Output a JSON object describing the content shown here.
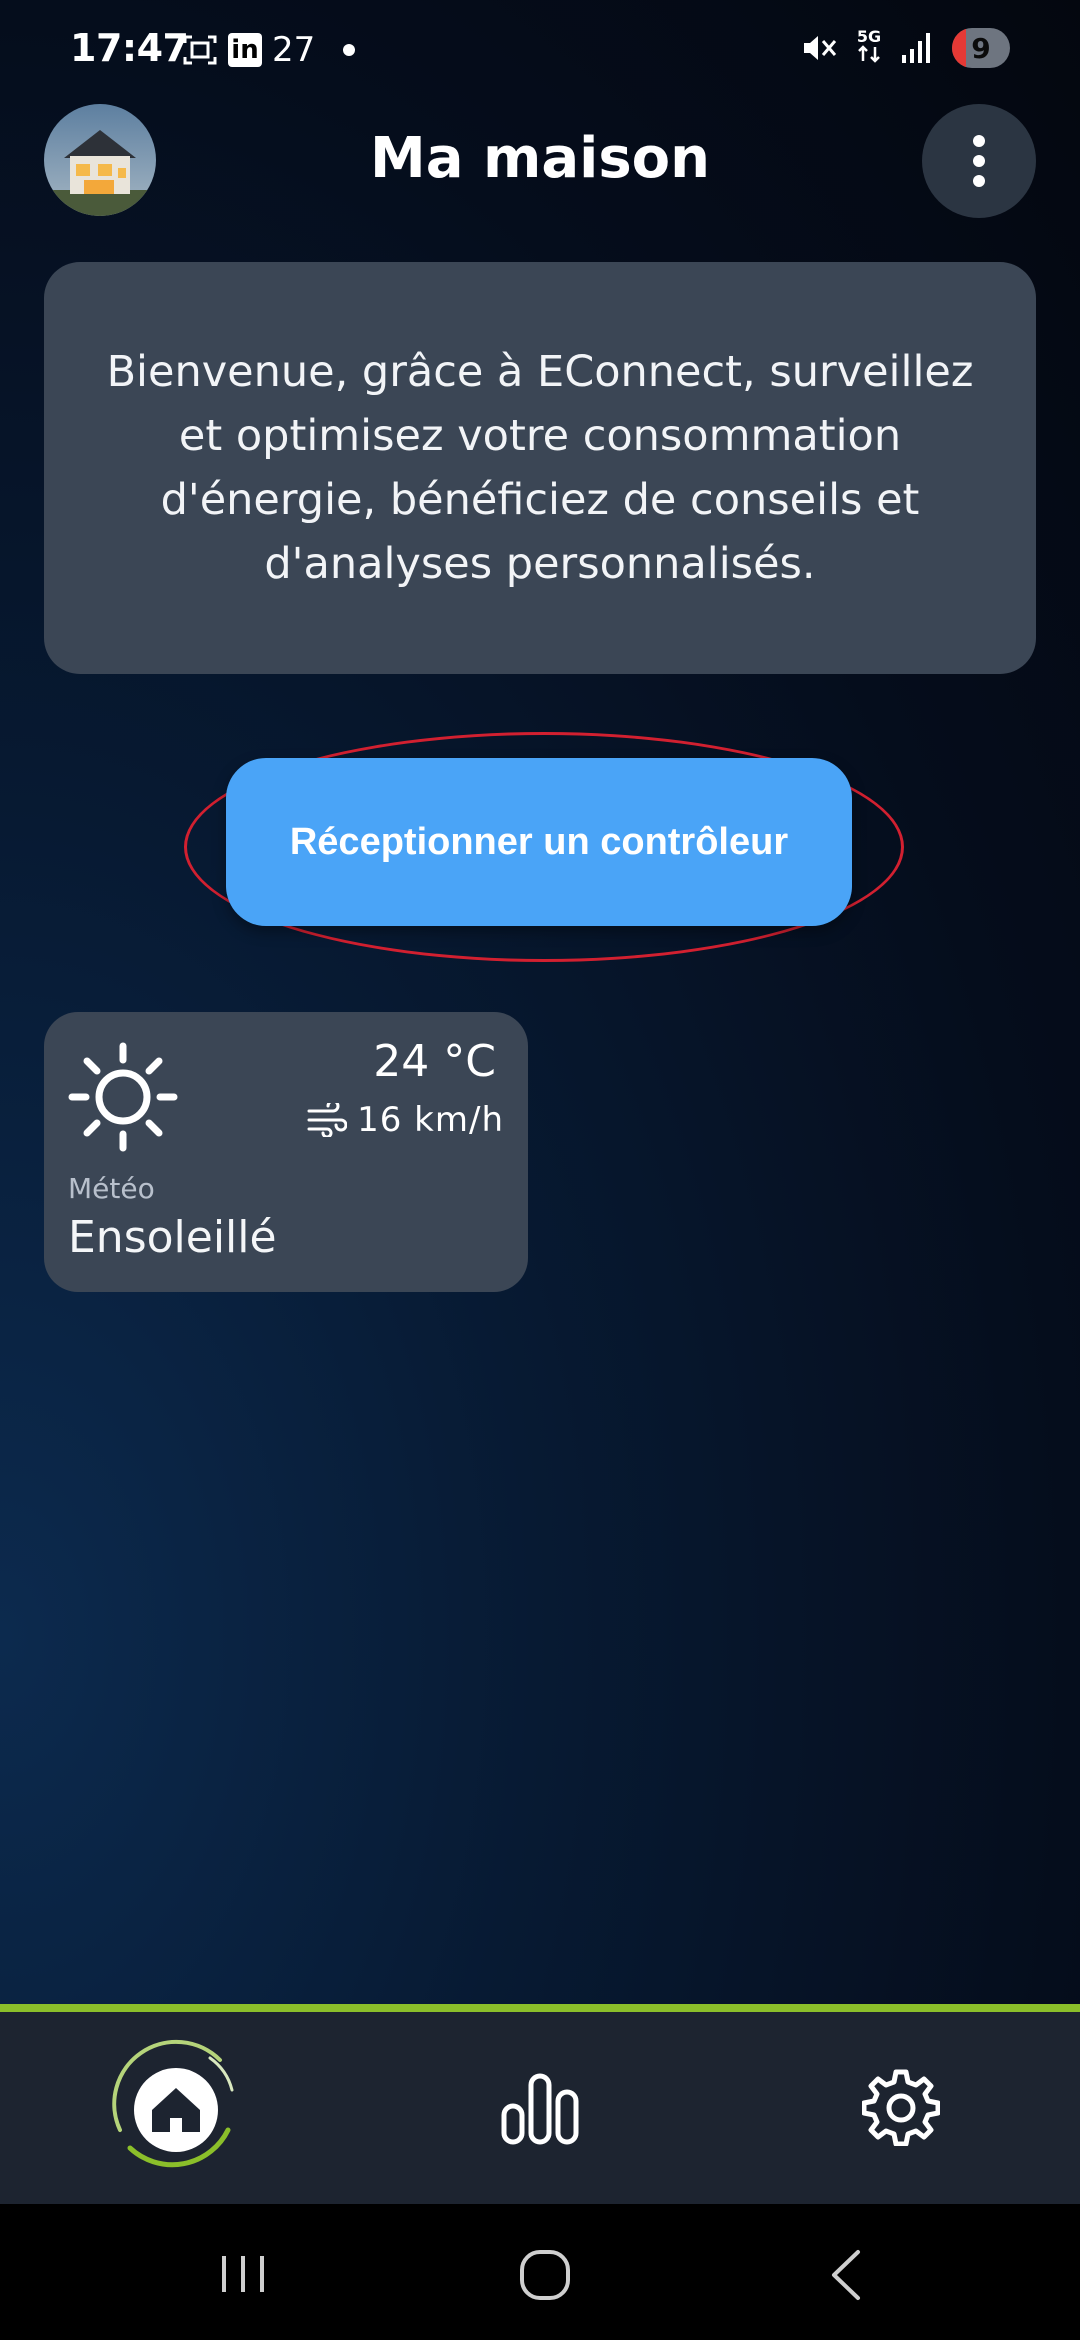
{
  "status_bar": {
    "time": "17:47",
    "notification_icons": [
      "screenshot-icon",
      "linkedin-icon"
    ],
    "linkedin_text": "in",
    "temperature": "27",
    "network": "5G",
    "battery_level": "9",
    "battery_color": "#e53935"
  },
  "header": {
    "title": "Ma maison",
    "avatar_icon": "house-avatar",
    "menu_icon": "more-vertical-icon"
  },
  "welcome": {
    "text": "Bienvenue, grâce à EConnect, surveillez et optimisez votre consommation d'énergie, bénéficiez de conseils et d'analyses personnalisés."
  },
  "cta": {
    "label": "Réceptionner un contrôleur",
    "color": "#4aa4f7",
    "highlight_color": "#d22030"
  },
  "weather": {
    "temperature": "24 °C",
    "wind": "16 km/h",
    "label": "Météo",
    "condition": "Ensoleillé",
    "icon": "sun-icon"
  },
  "bottom_nav": {
    "accent_color": "#8bbf2a",
    "items": [
      {
        "icon": "home-icon",
        "active": true
      },
      {
        "icon": "bar-chart-icon",
        "active": false
      },
      {
        "icon": "gear-icon",
        "active": false
      }
    ]
  },
  "system_nav": [
    "recents-icon",
    "home-outline-icon",
    "back-icon"
  ]
}
